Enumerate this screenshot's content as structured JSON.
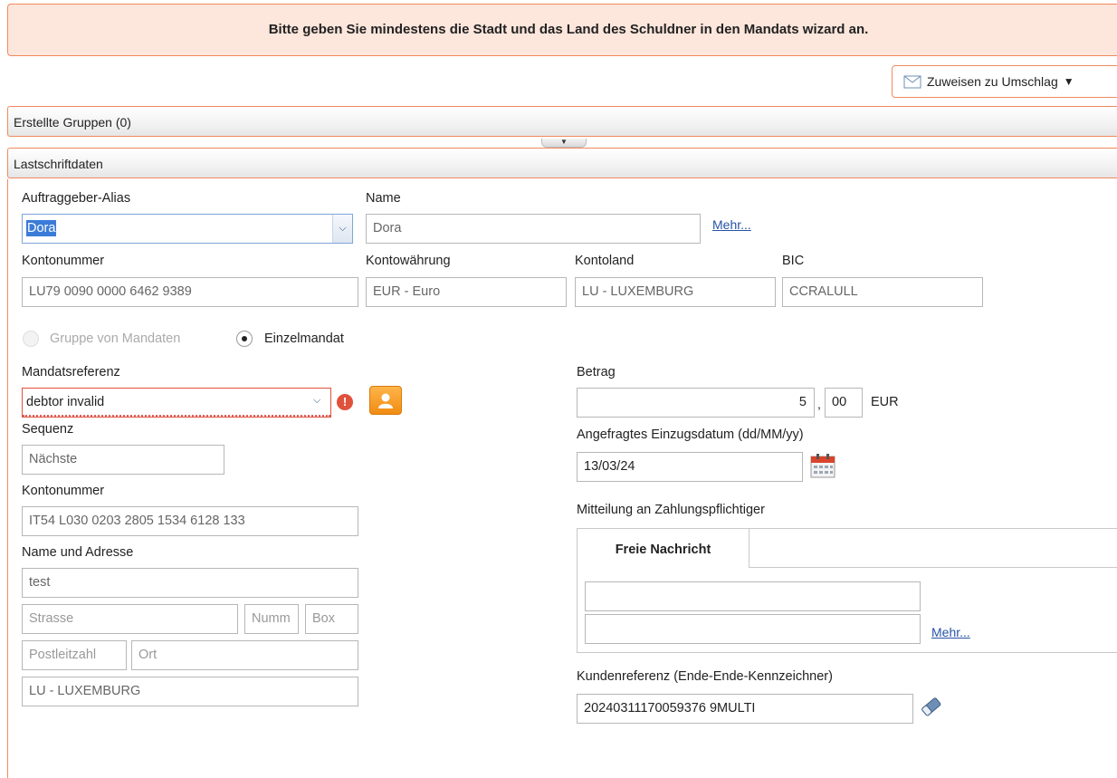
{
  "banner": {
    "message": "Bitte geben Sie mindestens die Stadt und das Land des Schuldner in den Mandats wizard an."
  },
  "toolbar": {
    "assign_label": "Zuweisen zu Umschlag"
  },
  "sections": {
    "groups_title": "Erstellte Gruppen (0)",
    "debit_title": "Lastschriftdaten"
  },
  "creditor": {
    "alias_label": "Auftraggeber-Alias",
    "alias_value": "Dora",
    "name_label": "Name",
    "name_value": "Dora",
    "more_link": "Mehr...",
    "account_label": "Kontonummer",
    "account_value": "LU79 0090 0000 6462 9389",
    "currency_label": "Kontowährung",
    "currency_value": "EUR - Euro",
    "country_label": "Kontoland",
    "country_value": "LU - LUXEMBURG",
    "bic_label": "BIC",
    "bic_value": "CCRALULL"
  },
  "mandate_type": {
    "group_label": "Gruppe von Mandaten",
    "single_label": "Einzelmandat",
    "selected": "Einzelmandat"
  },
  "debtor": {
    "mandate_ref_label": "Mandatsreferenz",
    "mandate_ref_value": "debtor invalid",
    "sequence_label": "Sequenz",
    "sequence_value": "Nächste",
    "account_label": "Kontonummer",
    "account_value": "IT54 L030 0203 2805 1534 6128 133",
    "name_address_label": "Name und Adresse",
    "name_value": "test",
    "street_placeholder": "Strasse",
    "number_placeholder": "Numm",
    "box_placeholder": "Box",
    "postcode_placeholder": "Postleitzahl",
    "city_placeholder": "Ort",
    "country_value": "LU - LUXEMBURG"
  },
  "payment": {
    "amount_label": "Betrag",
    "amount_int": "5",
    "amount_sep": ",",
    "amount_dec": "00",
    "currency": "EUR",
    "date_label": "Angefragtes Einzugsdatum (dd/MM/yy)",
    "date_value": "13/03/24",
    "message_label": "Mitteilung an Zahlungspflichtiger",
    "tab_label": "Freie Nachricht",
    "message_line1": "",
    "message_line2": "",
    "more_link": "Mehr...",
    "endtoend_label": "Kundenreferenz (Ende-Ende-Kennzeichner)",
    "endtoend_value": "20240311170059376 9MULTI"
  },
  "colors": {
    "accent_border": "#f08a5d",
    "banner_bg": "#fde6dc",
    "link": "#2653a4",
    "error": "#e0523b"
  }
}
